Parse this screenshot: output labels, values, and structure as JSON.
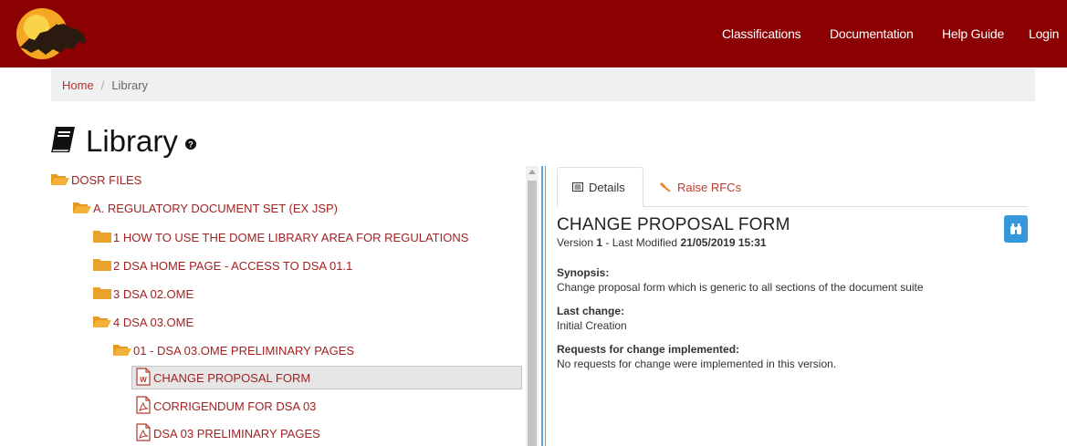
{
  "nav": {
    "items": [
      {
        "label": "Classifications"
      },
      {
        "label": "Documentation"
      },
      {
        "label": "Help Guide"
      },
      {
        "label": "Login"
      }
    ]
  },
  "breadcrumb": {
    "home": "Home",
    "separator": "/",
    "current": "Library"
  },
  "page": {
    "title": "Library"
  },
  "tree": {
    "items": [
      {
        "label": "DOSR FILES",
        "icon": "folder-open-icon"
      },
      {
        "label": "A. REGULATORY DOCUMENT SET (EX JSP)",
        "icon": "folder-open-icon"
      },
      {
        "label": "1 HOW TO USE THE DOME LIBRARY AREA FOR REGULATIONS",
        "icon": "folder-icon"
      },
      {
        "label": "2 DSA HOME PAGE - ACCESS TO DSA 01.1",
        "icon": "folder-icon"
      },
      {
        "label": "3 DSA 02.OME",
        "icon": "folder-icon"
      },
      {
        "label": "4 DSA 03.OME",
        "icon": "folder-open-icon"
      },
      {
        "label": "01 - DSA 03.OME PRELIMINARY PAGES",
        "icon": "folder-open-icon"
      },
      {
        "label": "CHANGE PROPOSAL FORM",
        "icon": "word-doc-icon",
        "selected": true
      },
      {
        "label": "CORRIGENDUM FOR DSA 03",
        "icon": "pdf-doc-icon"
      },
      {
        "label": "DSA 03 PRELIMINARY PAGES",
        "icon": "pdf-doc-icon"
      }
    ]
  },
  "tabs": {
    "details": "Details",
    "rfc": "Raise RFCs"
  },
  "document": {
    "title": "CHANGE PROPOSAL FORM",
    "version_prefix": "Version",
    "version": "1",
    "modified_prefix": "- Last Modified",
    "modified": "21/05/2019 15:31",
    "synopsis_label": "Synopsis:",
    "synopsis": "Change proposal form which is generic to all sections of the document suite",
    "last_change_label": "Last change:",
    "last_change": "Initial Creation",
    "rfc_label": "Requests for change implemented:",
    "rfc_value": "No requests for change were implemented in this version."
  },
  "colors": {
    "header": "#8b0000",
    "link": "#a22222",
    "accent_blue": "#3498db",
    "folder": "#f0a830"
  }
}
